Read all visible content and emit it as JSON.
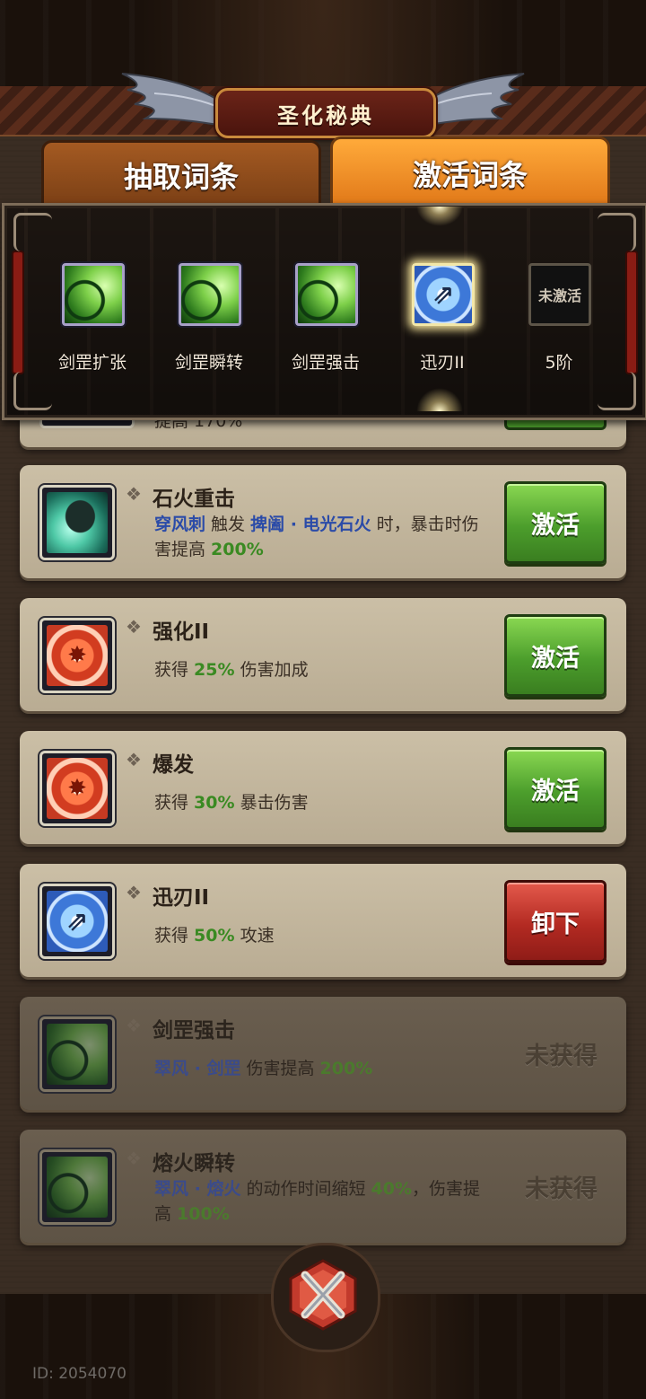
{
  "header": {
    "title": "圣化秘典"
  },
  "tabs": [
    {
      "label": "抽取词条",
      "active": false
    },
    {
      "label": "激活词条",
      "active": true
    }
  ],
  "slots": [
    {
      "label": "剑罡扩张",
      "icon": "sword-wind-icon",
      "color": "#5fb43a"
    },
    {
      "label": "剑罡瞬转",
      "icon": "sword-wind-icon",
      "color": "#5fb43a"
    },
    {
      "label": "剑罡强击",
      "icon": "sword-wind-icon",
      "color": "#5fb43a"
    },
    {
      "label": "迅刃II",
      "icon": "swift-blade-icon",
      "color": "#4a86de",
      "selected": true
    },
    {
      "label": "5阶",
      "placeholder": "未激活"
    }
  ],
  "partial_card": {
    "text": "提高 170%"
  },
  "cards": [
    {
      "name": "石火重击",
      "icon": "wind-fang-icon",
      "desc": [
        {
          "t": "穿风刺",
          "k": "kw"
        },
        {
          "t": " 触发 "
        },
        {
          "t": "捭阖 · 电光石火",
          "k": "kw"
        },
        {
          "t": " 时，暴击时伤害提高 "
        },
        {
          "t": "200%",
          "k": "pct"
        }
      ],
      "action": "激活",
      "action_type": "activate"
    },
    {
      "name": "强化II",
      "icon": "flame-burst-icon",
      "desc": [
        {
          "t": "获得 "
        },
        {
          "t": "25%",
          "k": "pct"
        },
        {
          "t": " 伤害加成"
        }
      ],
      "action": "激活",
      "action_type": "activate"
    },
    {
      "name": "爆发",
      "icon": "flame-burst-icon",
      "desc": [
        {
          "t": "获得 "
        },
        {
          "t": "30%",
          "k": "pct"
        },
        {
          "t": " 暴击伤害"
        }
      ],
      "action": "激活",
      "action_type": "activate"
    },
    {
      "name": "迅刃II",
      "icon": "swift-blade-icon",
      "desc": [
        {
          "t": "获得 "
        },
        {
          "t": "50%",
          "k": "pct"
        },
        {
          "t": " 攻速"
        }
      ],
      "action": "卸下",
      "action_type": "unequip"
    },
    {
      "name": "剑罡强击",
      "icon": "sword-wind-icon",
      "desc": [
        {
          "t": "翠风 · 剑罡",
          "k": "kw"
        },
        {
          "t": " 伤害提高 "
        },
        {
          "t": "200%",
          "k": "pct"
        }
      ],
      "action": "未获得",
      "action_type": "locked"
    },
    {
      "name": "熔火瞬转",
      "icon": "sword-wind-icon",
      "desc": [
        {
          "t": "翠风 · 熔火",
          "k": "kw"
        },
        {
          "t": " 的动作时间缩短 "
        },
        {
          "t": "40%",
          "k": "pct"
        },
        {
          "t": "，伤害提高 "
        },
        {
          "t": "100%",
          "k": "pct"
        }
      ],
      "action": "未获得",
      "action_type": "locked"
    }
  ],
  "footer": {
    "id_text": "ID: 2054070",
    "close_icon": "close-x-icon"
  },
  "colors": {
    "activate": "#4c9e2c",
    "unequip": "#b32a22",
    "accent": "#e07718"
  }
}
